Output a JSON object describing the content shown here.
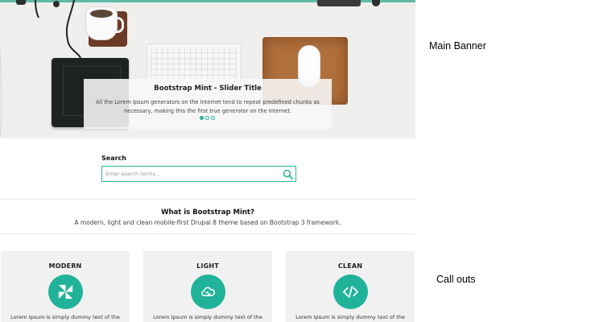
{
  "banner": {
    "slide_title": "Bootstrap Mint - Slider Title",
    "slide_text": "All the Lorem Ipsum generators on the Internet tend to repeat predefined chunks as necessary, making this the first true generator on the Internet.",
    "indicators": {
      "count": 3,
      "active_index": 0
    },
    "accent_color": "#27b59a"
  },
  "search": {
    "label": "Search",
    "placeholder": "Enter search terms...",
    "value": "",
    "icon": "search-icon"
  },
  "about": {
    "title": "What is Bootstrap Mint?",
    "text": "A modern, light and clean mobile-first Drupal 8 theme based on Bootstrap 3 framework."
  },
  "callouts": [
    {
      "title": "MODERN",
      "icon": "pinwheel-icon",
      "text": "Lorem Ipsum is simply dummy text of the"
    },
    {
      "title": "LIGHT",
      "icon": "cloud-icon",
      "text": "Lorem Ipsum is simply dummy text of the"
    },
    {
      "title": "CLEAN",
      "icon": "code-icon",
      "text": "Lorem Ipsum is simply dummy text of the"
    }
  ],
  "annotations": {
    "main_banner": "Main Banner",
    "call_outs": "Call outs"
  }
}
